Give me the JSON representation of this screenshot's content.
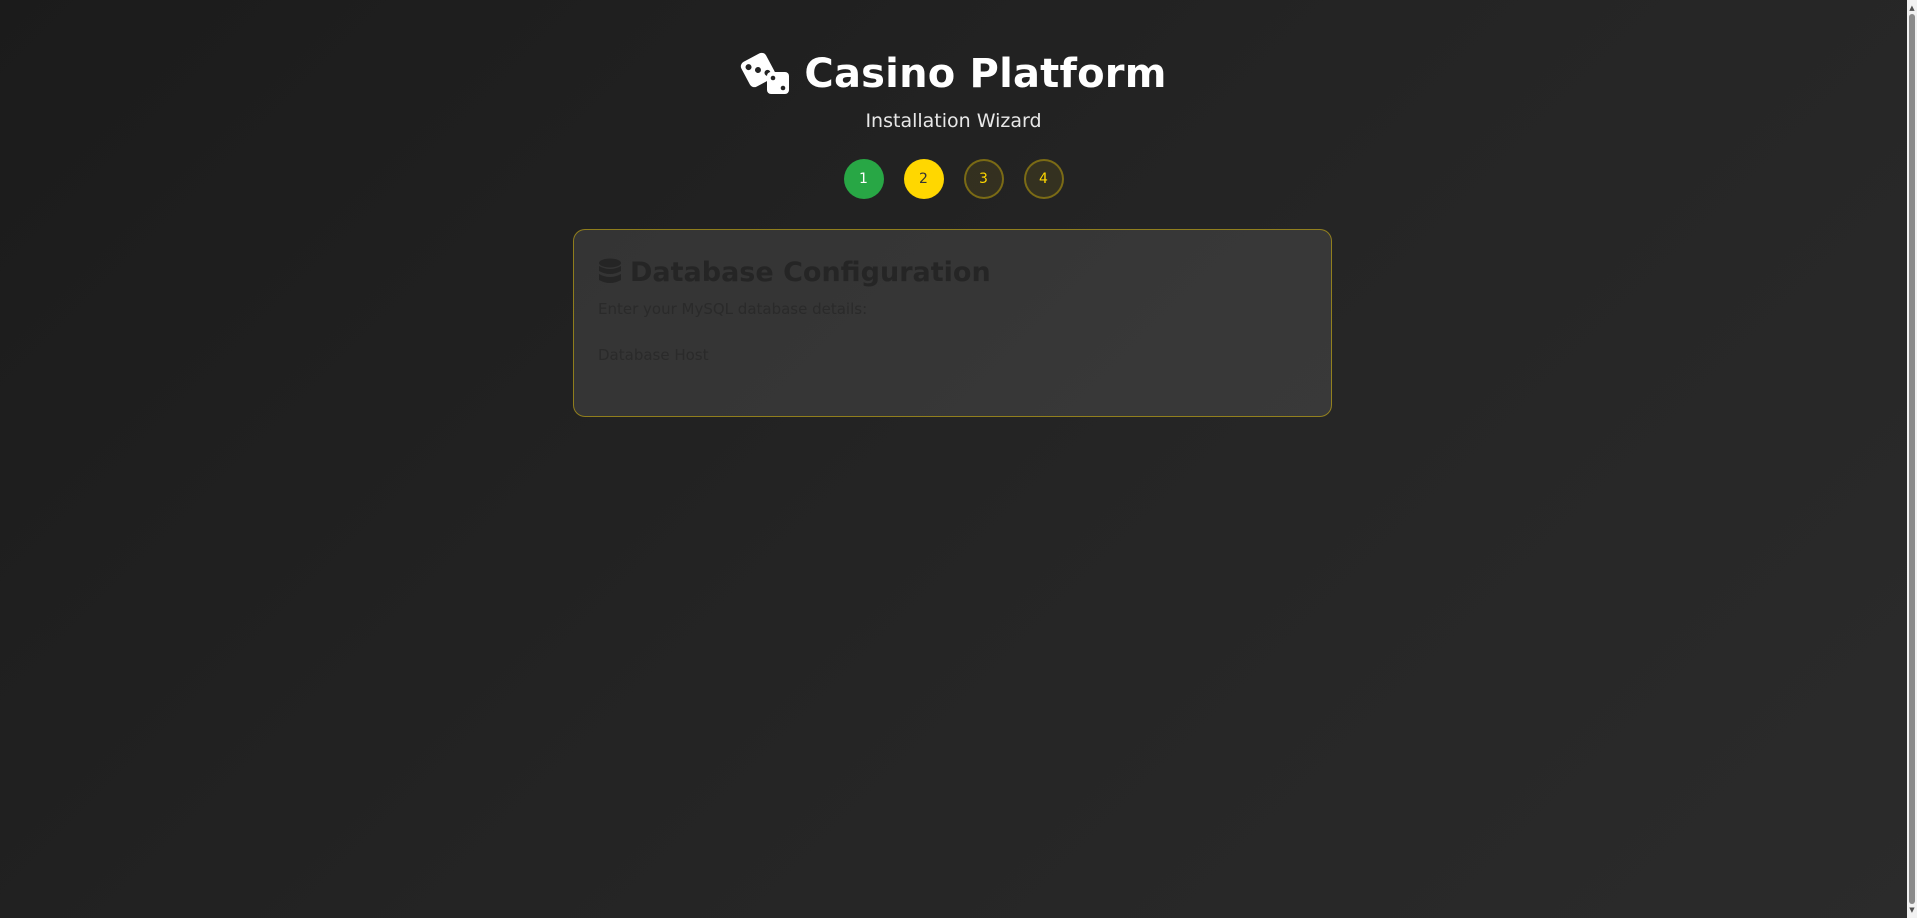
{
  "header": {
    "logo_icon": "dice-icon",
    "title": "Casino Platform",
    "subtitle": "Installation Wizard"
  },
  "steps": [
    {
      "label": "1",
      "state": "completed",
      "color": "#28a745"
    },
    {
      "label": "2",
      "state": "active",
      "color": "#ffd700"
    },
    {
      "label": "3",
      "state": "pending"
    },
    {
      "label": "4",
      "state": "pending"
    }
  ],
  "card": {
    "icon": "database-icon",
    "title": "Database Configuration",
    "description": "Enter your MySQL database details:",
    "fields": [
      {
        "label": "Database Host"
      }
    ]
  },
  "colors": {
    "accent": "#ffd700",
    "success": "#28a745",
    "background": "#222222"
  }
}
